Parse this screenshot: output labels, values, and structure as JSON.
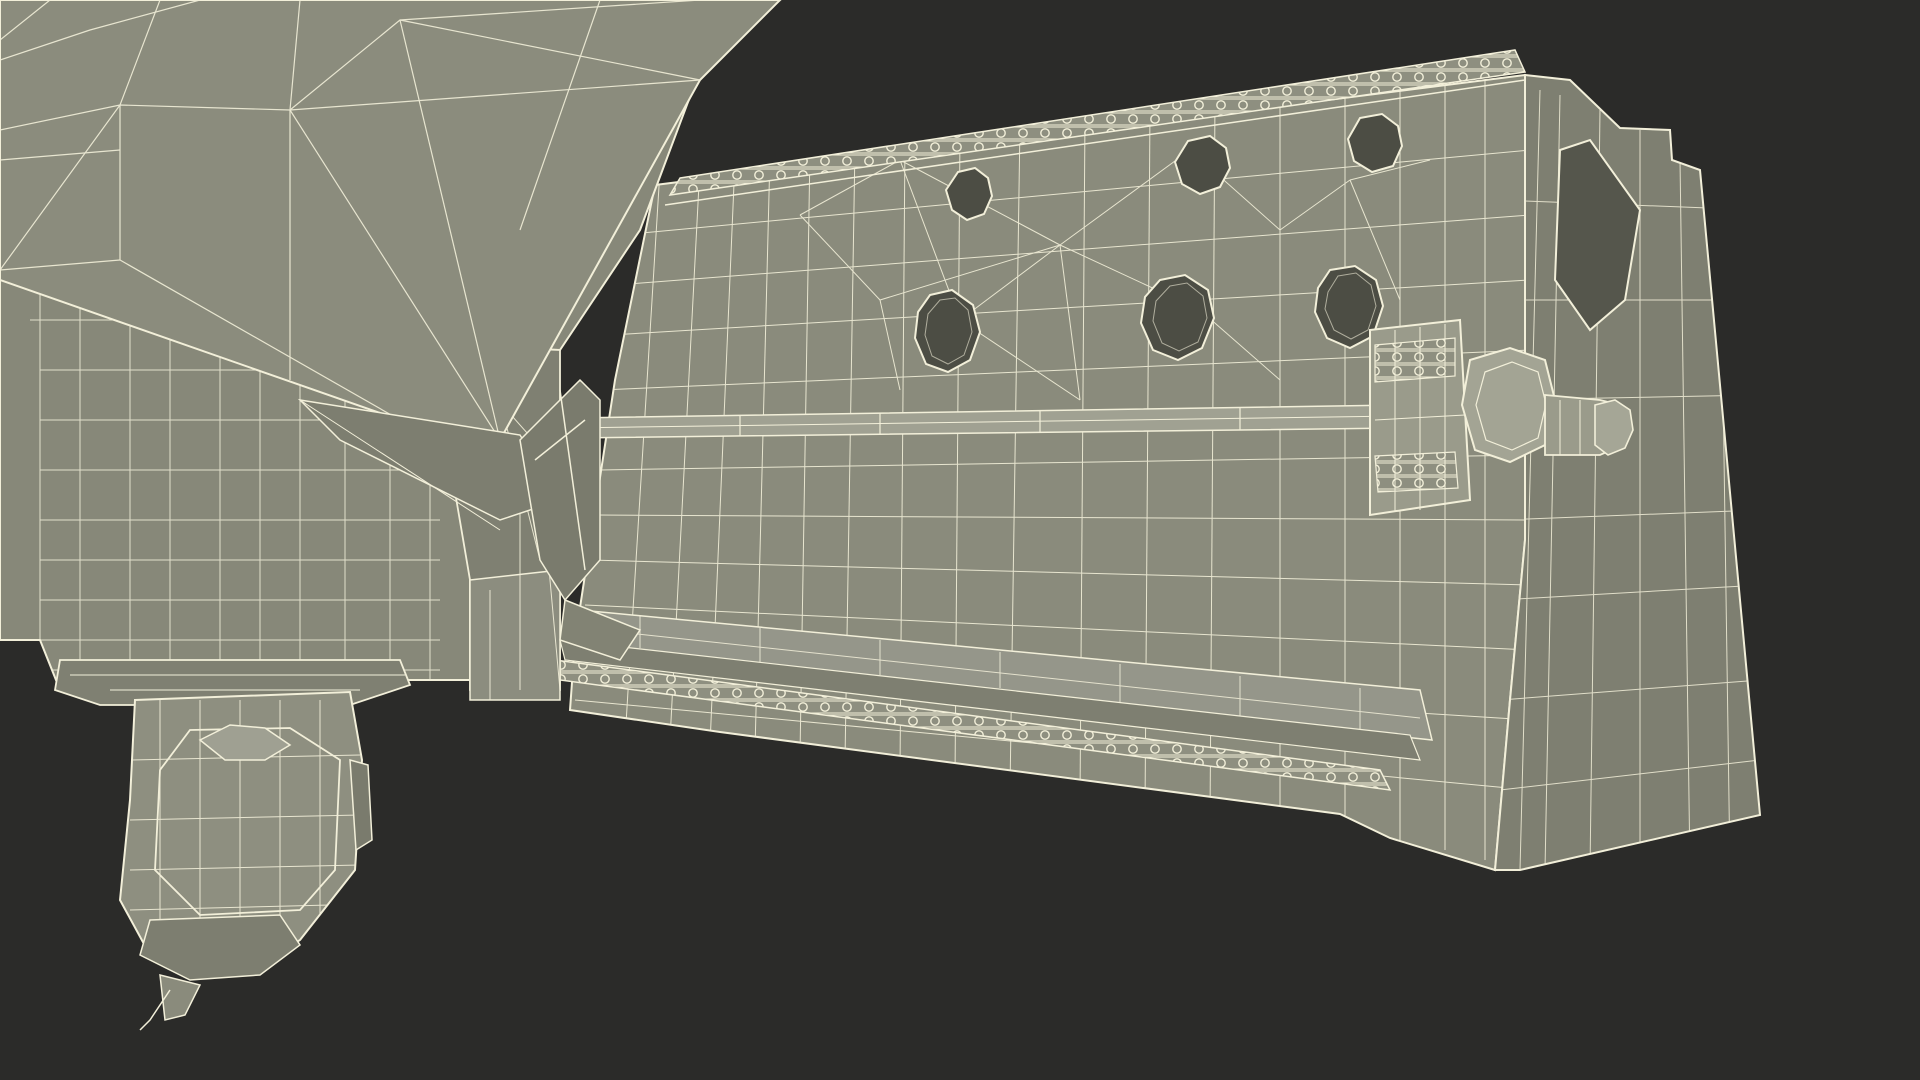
{
  "scene": {
    "colors": {
      "background": "#2b2b29",
      "surface": "#8a8b7c",
      "surface_light": "#9a9b8b",
      "surface_dark": "#6f7062",
      "hole": "#4c4d44",
      "wire": "#f2efd9"
    }
  }
}
